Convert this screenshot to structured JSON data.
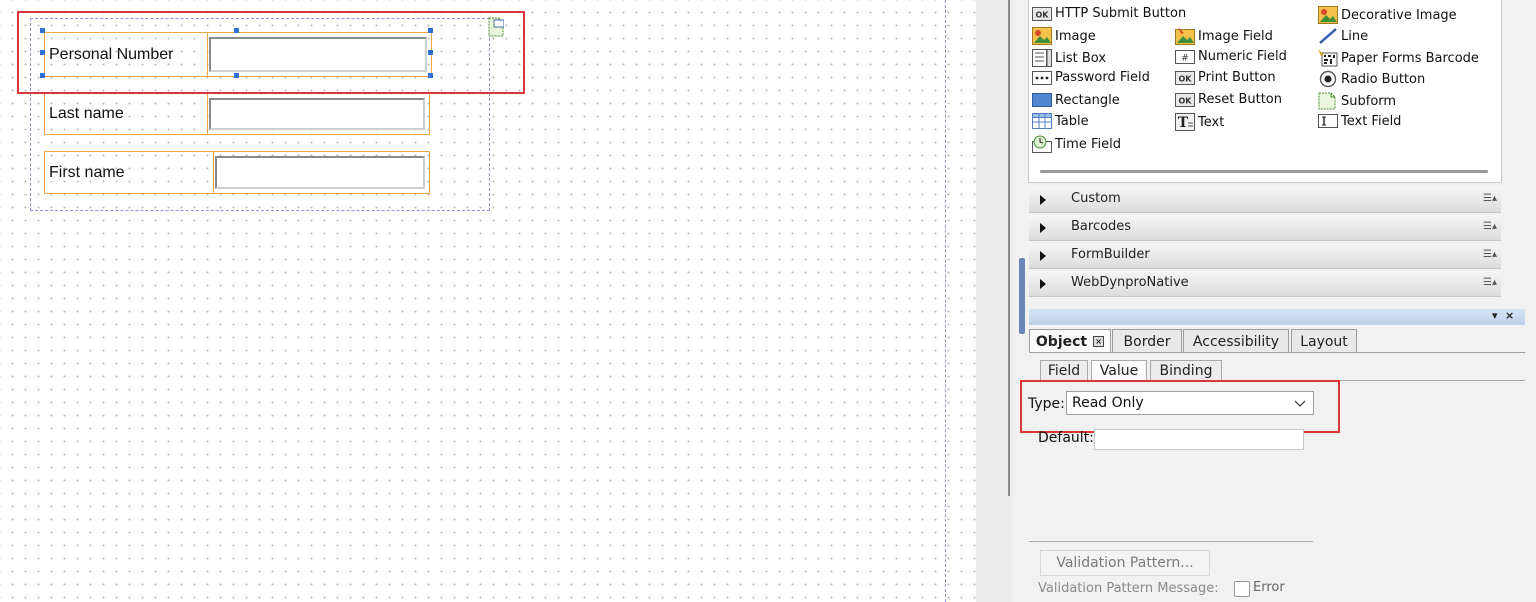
{
  "form": {
    "fields": [
      {
        "caption": "Personal Number"
      },
      {
        "caption": "Last name"
      },
      {
        "caption": "First name"
      }
    ]
  },
  "object_library": {
    "items": [
      {
        "label": "HTTP Submit Button",
        "icon": "ok-button-icon"
      },
      {
        "label": "Decorative Image",
        "icon": "image-icon"
      },
      {
        "label": "Image",
        "icon": "image-icon"
      },
      {
        "label": "Image Field",
        "icon": "image-field-icon"
      },
      {
        "label": "Line",
        "icon": "line-icon"
      },
      {
        "label": "List Box",
        "icon": "list-box-icon"
      },
      {
        "label": "Numeric Field",
        "icon": "numeric-field-icon"
      },
      {
        "label": "Paper Forms Barcode",
        "icon": "barcode-icon"
      },
      {
        "label": "Password Field",
        "icon": "password-field-icon"
      },
      {
        "label": "Print Button",
        "icon": "ok-button-icon"
      },
      {
        "label": "Radio Button",
        "icon": "radio-button-icon"
      },
      {
        "label": "Rectangle",
        "icon": "rectangle-icon"
      },
      {
        "label": "Reset Button",
        "icon": "ok-button-icon"
      },
      {
        "label": "Subform",
        "icon": "subform-icon"
      },
      {
        "label": "Table",
        "icon": "table-icon"
      },
      {
        "label": "Text",
        "icon": "text-icon"
      },
      {
        "label": "Text Field",
        "icon": "text-field-icon"
      },
      {
        "label": "Time Field",
        "icon": "time-field-icon"
      }
    ],
    "button_badge": "OK",
    "numeric_badge": "#",
    "text_badge": "T",
    "categories": [
      "Custom",
      "Barcodes",
      "FormBuilder",
      "WebDynproNative"
    ]
  },
  "palette": {
    "tabs": [
      "Object",
      "Border",
      "Accessibility",
      "Layout"
    ],
    "subtabs": [
      "Field",
      "Value",
      "Binding"
    ],
    "type_label": "Type:",
    "type_value": "Read Only",
    "default_label": "Default:",
    "validation_pattern_button": "Validation Pattern...",
    "validation_message_label": "Validation Pattern Message:",
    "error_label": "Error"
  },
  "colors": {
    "highlight": "#d9373b",
    "field_border": "#f0a642",
    "selection_handle": "#2f6fd6"
  }
}
